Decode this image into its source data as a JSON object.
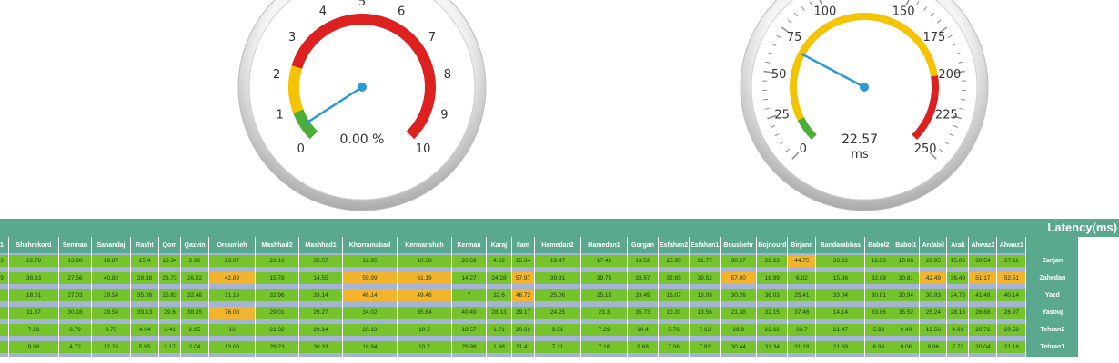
{
  "gauges": {
    "loss": {
      "ticks": [
        "0",
        "1",
        "2",
        "3",
        "4",
        "5",
        "6",
        "7",
        "8",
        "9",
        "10"
      ],
      "readout": "0.00 %",
      "value": 0,
      "max": 10,
      "colors": {
        "green": "#4caf35",
        "yellow": "#f5c400",
        "red": "#dd2020",
        "needle": "#2a9bd8"
      }
    },
    "latency": {
      "ticks": [
        "0",
        "25",
        "50",
        "75",
        "100",
        "150",
        "175",
        "200",
        "225",
        "250"
      ],
      "readout_value": "22.57",
      "readout_unit": "ms",
      "value": 22.57,
      "max": 250,
      "colors": {
        "green": "#4caf35",
        "yellow": "#f5c400",
        "red": "#dd2020",
        "needle": "#2a9bd8"
      }
    }
  },
  "latency_panel": {
    "title": "Latency(ms)",
    "columns": [
      "1",
      "Shahrekord",
      "Semnan",
      "Sanandaj",
      "Rasht",
      "Qom",
      "Qazvin",
      "Oroumieh",
      "Mashhad2",
      "Mashhad1",
      "Khorramabad",
      "Kermanshah",
      "Kerman",
      "Karaj",
      "Ilam",
      "Hamedan2",
      "Hamedan1",
      "Gorgan",
      "Esfahan2",
      "Esfahan1",
      "Boushehr",
      "Bojnourd",
      "Birjand",
      "Bandarabbas",
      "Babol2",
      "Babol1",
      "Ardabil",
      "Arak",
      "Ahwaz2",
      "Ahwaz1",
      ""
    ],
    "rows": [
      {
        "city": "Zanjan",
        "cells": [
          "3",
          "22.78",
          "13.98",
          "19.87",
          "15.4",
          "13.34",
          "2.86",
          "23.07",
          "23.16",
          "35.57",
          "12.95",
          "10.38",
          "26.59",
          "4.22",
          "15.34",
          "19.47",
          "17.42",
          "13.52",
          "15.95",
          "21.77",
          "30.27",
          "26.23",
          "44.75",
          "33.22",
          "16.56",
          "10.86",
          "20.95",
          "15.06",
          "30.54",
          "27.11"
        ],
        "hi": [
          22
        ]
      },
      {
        "city": "Zahedan",
        "cells": [
          "9",
          "38.63",
          "27.56",
          "40.82",
          "28.38",
          "26.73",
          "26.52",
          "42.89",
          "15.78",
          "14.55",
          "59.99",
          "61.19",
          "14.27",
          "24.28",
          "57.97",
          "39.81",
          "39.75",
          "33.57",
          "32.65",
          "39.52",
          "57.00",
          "18.99",
          "6.02",
          "15.96",
          "32.08",
          "30.81",
          "42.49",
          "36.49",
          "51.17",
          "52.51"
        ],
        "hi": [
          7,
          10,
          11,
          14,
          20,
          26,
          28,
          29
        ]
      },
      {
        "city": "Yazd",
        "cells": [
          "",
          "18.01",
          "27.03",
          "29.54",
          "35.06",
          "25.83",
          "32.46",
          "31.16",
          "32.96",
          "33.14",
          "46.14",
          "49.46",
          "7",
          "32.6",
          "46.72",
          "25.06",
          "25.15",
          "33.49",
          "16.07",
          "16.08",
          "30.26",
          "36.03",
          "25.41",
          "33.04",
          "30.81",
          "30.94",
          "30.93",
          "24.73",
          "41.48",
          "40.14"
        ],
        "hi": [
          10,
          11,
          14
        ]
      },
      {
        "city": "Yasouj",
        "cells": [
          "",
          "11.87",
          "30.18",
          "29.54",
          "39.13",
          "29.6",
          "38.35",
          "76.08",
          "29.01",
          "29.27",
          "34.02",
          "35.64",
          "40.49",
          "28.13",
          "29.17",
          "24.25",
          "23.3",
          "35.73",
          "10.31",
          "13.56",
          "21.38",
          "32.15",
          "37.46",
          "14.14",
          "33.86",
          "35.52",
          "25.24",
          "28.16",
          "26.88",
          "26.97"
        ],
        "hi": [
          7
        ]
      },
      {
        "city": "Tehran2",
        "cells": [
          "",
          "7.29",
          "3.79",
          "9.75",
          "4.94",
          "3.41",
          "2.05",
          "13",
          "21.32",
          "29.14",
          "20.13",
          "10.5",
          "18.57",
          "1.71",
          "20.62",
          "9.51",
          "7.29",
          "10.4",
          "5.76",
          "7.63",
          "29.9",
          "22.62",
          "33.7",
          "21.47",
          "5.99",
          "9.49",
          "12.56",
          "4.91",
          "20.72",
          "20.58"
        ],
        "hi": []
      },
      {
        "city": "Tehran1",
        "cells": [
          "",
          "9.98",
          "4.72",
          "12.26",
          "5.95",
          "3.17",
          "2.04",
          "13.03",
          "29.23",
          "30.33",
          "18.94",
          "10.7",
          "25.98",
          "1.88",
          "21.41",
          "7.21",
          "7.16",
          "9.68",
          "7.06",
          "7.92",
          "30.44",
          "31.34",
          "31.18",
          "21.69",
          "6.99",
          "9.06",
          "8.96",
          "7.72",
          "20.04",
          "21.18"
        ],
        "hi": []
      }
    ]
  }
}
